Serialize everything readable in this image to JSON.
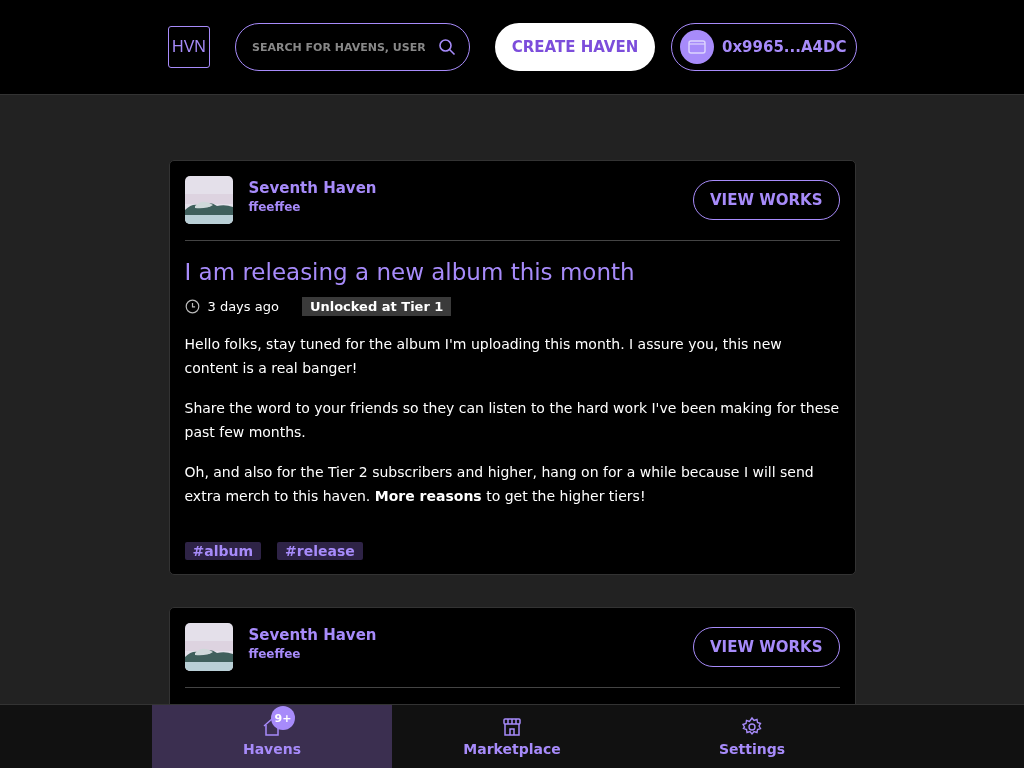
{
  "header": {
    "logo": "HVN",
    "search": {
      "placeholder": "SEARCH FOR HAVENS, USER"
    },
    "create_button": "CREATE HAVEN",
    "wallet": "0x9965...A4DC"
  },
  "posts": [
    {
      "haven": "Seventh Haven",
      "owner": "ffeeffee",
      "button": "VIEW WORKS",
      "title": "I am releasing a new album this month",
      "time": "3 days ago",
      "tier": "Unlocked at Tier 1",
      "paragraphs": [
        "Hello folks, stay tuned for the album I'm uploading this month. I assure you, this new content is a real banger!",
        "Share the word to your friends so they can listen to the hard work I've been making for these past few months.",
        "Oh, and also for the Tier 2 subscribers and higher, hang on for a while because I will send extra merch to this haven. **More reasons** to get the higher tiers!"
      ],
      "tags": [
        "#album",
        "#release"
      ]
    },
    {
      "haven": "Seventh Haven",
      "owner": "ffeeffee",
      "button": "VIEW WORKS"
    }
  ],
  "nav": [
    {
      "kind": "home",
      "label": "Havens",
      "selected": true,
      "badge": "9+"
    },
    {
      "kind": "store",
      "label": "Marketplace",
      "selected": false
    },
    {
      "kind": "gear",
      "label": "Settings",
      "selected": false
    }
  ]
}
